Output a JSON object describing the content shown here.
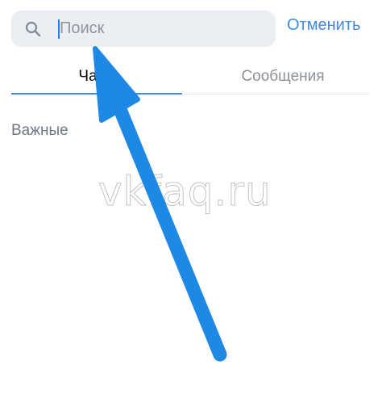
{
  "search": {
    "placeholder": "Поиск",
    "cancel_label": "Отменить"
  },
  "tabs": [
    {
      "label": "Чаты",
      "active": true
    },
    {
      "label": "Сообщения",
      "active": false
    }
  ],
  "section": {
    "title": "Важные"
  },
  "watermark": "vkfaq.ru",
  "colors": {
    "accent": "#3f8ae0",
    "search_bg": "#ebeef2",
    "arrow": "#1e88e5"
  }
}
